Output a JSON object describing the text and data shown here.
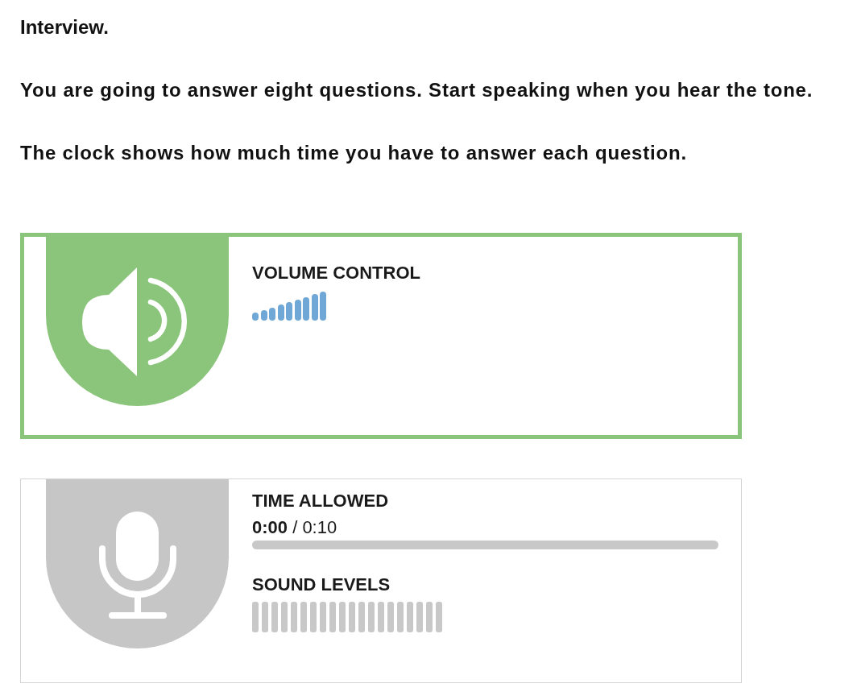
{
  "title": "Interview.",
  "paragraphs": [
    "You are going to answer eight questions. Start speaking when you hear the tone.",
    "The clock shows how much time you have to answer each question."
  ],
  "panels": [
    {
      "kind": "volume",
      "active": true,
      "label": "VOLUME CONTROL",
      "bars": [
        {
          "on": true
        },
        {
          "on": true
        },
        {
          "on": true
        },
        {
          "on": true
        },
        {
          "on": true
        },
        {
          "on": true
        },
        {
          "on": true
        },
        {
          "on": true
        },
        {
          "on": true
        }
      ]
    },
    {
      "kind": "recording",
      "active": false,
      "time_label": "TIME ALLOWED",
      "time": "**0:00** / 0:10",
      "sound_label": "SOUND LEVELS",
      "sound_bars": [
        {
          "on": false
        },
        {
          "on": false
        },
        {
          "on": false
        },
        {
          "on": false
        },
        {
          "on": false
        },
        {
          "on": false
        },
        {
          "on": false
        },
        {
          "on": false
        },
        {
          "on": false
        },
        {
          "on": false
        },
        {
          "on": false
        },
        {
          "on": false
        },
        {
          "on": false
        },
        {
          "on": false
        },
        {
          "on": false
        },
        {
          "on": false
        },
        {
          "on": false
        },
        {
          "on": false
        },
        {
          "on": false
        },
        {
          "on": false
        }
      ]
    }
  ]
}
